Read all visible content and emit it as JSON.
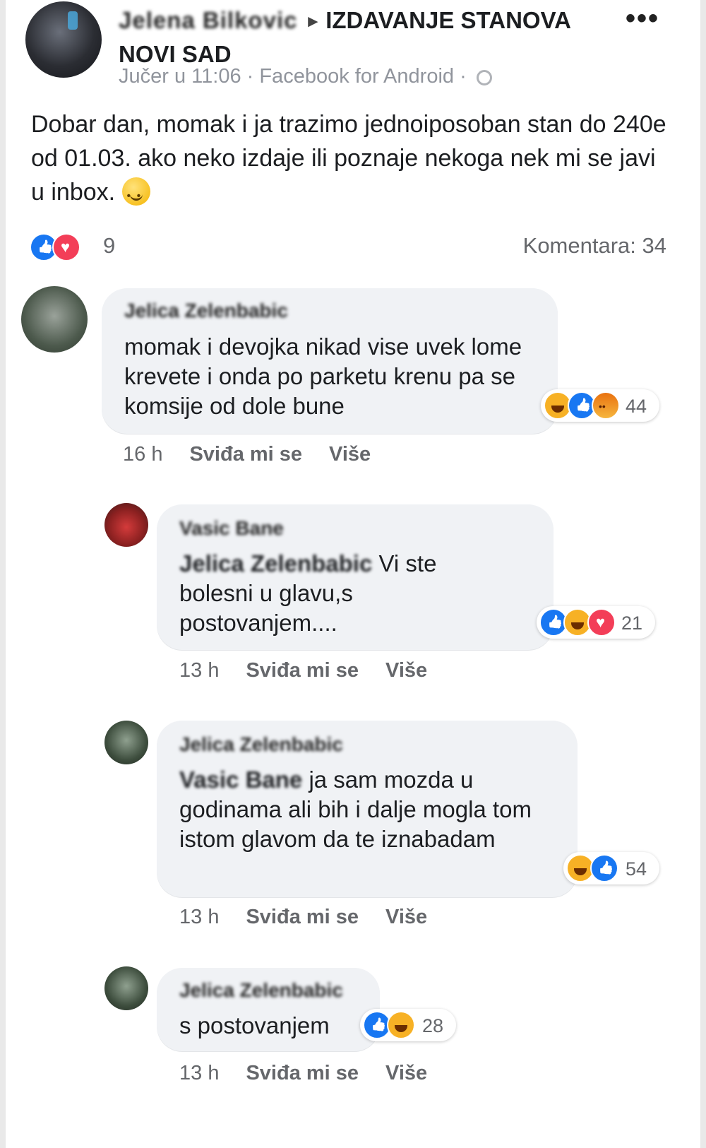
{
  "post": {
    "author": "Jelena Bilkovic",
    "group": "IZDAVANJE STANOVA NOVI SAD",
    "meta": "Jučer u 11:06 · Facebook for Android ·",
    "text": "Dobar dan, momak i ja trazimo jednoiposoban stan do 240e od 01.03. ako neko izdaje ili poznaje nekoga nek mi se javi u inbox.",
    "reaction_icons": [
      "like-icon",
      "love-icon"
    ],
    "reaction_count": "9",
    "comments_count": "Komentara: 34",
    "more_label": "•••"
  },
  "comments": [
    {
      "author": "Jelica Zelenbabic",
      "mention": "",
      "text": "momak i devojka nikad vise uvek lome krevete i onda po parketu krenu pa se komsije od dole bune",
      "reaction_icons": [
        "haha-icon",
        "like-icon",
        "angry-icon"
      ],
      "reaction_count": "44",
      "time": "16 h",
      "like": "Sviđa mi se",
      "more": "Više"
    },
    {
      "author": "Vasic Bane",
      "mention": "Jelica Zelenbabic",
      "text": " Vi ste bolesni u glavu,s postovanjem....",
      "reaction_icons": [
        "like-icon",
        "haha-icon",
        "love-icon"
      ],
      "reaction_count": "21",
      "time": "13 h",
      "like": "Sviđa mi se",
      "more": "Više"
    },
    {
      "author": "Jelica Zelenbabic",
      "mention": "Vasic Bane",
      "text": " ja sam mozda u godinama ali bih i dalje mogla tom istom glavom da te iznabadam",
      "reaction_icons": [
        "haha-icon",
        "like-icon"
      ],
      "reaction_count": "54",
      "time": "13 h",
      "like": "Sviđa mi se",
      "more": "Više"
    },
    {
      "author": "Jelica Zelenbabic",
      "mention": "",
      "text": "s postovanjem",
      "reaction_icons": [
        "like-icon",
        "haha-icon"
      ],
      "reaction_count": "28",
      "time": "13 h",
      "like": "Sviđa mi se",
      "more": "Više"
    }
  ]
}
